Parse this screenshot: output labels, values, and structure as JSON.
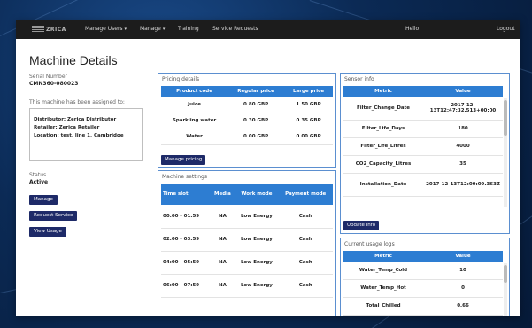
{
  "navbar": {
    "brand": "ZRICA",
    "items": [
      {
        "label": "Manage Users",
        "dropdown": true
      },
      {
        "label": "Manage",
        "dropdown": true
      },
      {
        "label": "Training",
        "dropdown": false
      },
      {
        "label": "Service Requests",
        "dropdown": false
      }
    ],
    "hello": "Hello",
    "logout": "Logout"
  },
  "page": {
    "title": "Machine Details",
    "serial_label": "Serial Number",
    "serial_value": "CMN360-080023",
    "assigned_label": "This machine has been assigned to:",
    "assigned_lines": [
      "Distributor: Zerica Distributor",
      "Retailer: Zerica Retailer",
      "Location: test, line 1, Cambridge"
    ],
    "status_label": "Status",
    "status_value": "Active",
    "buttons": {
      "manage": "Manage",
      "request_service": "Request Service",
      "view_usage": "View Usage"
    }
  },
  "pricing": {
    "title": "Pricing details",
    "headers": [
      "Product code",
      "Regular price",
      "Large price"
    ],
    "rows": [
      [
        "Juice",
        "0.80 GBP",
        "1.50 GBP"
      ],
      [
        "Sparkling water",
        "0.30 GBP",
        "0.35 GBP"
      ],
      [
        "Water",
        "0.00 GBP",
        "0.00 GBP"
      ]
    ],
    "button": "Manage pricing"
  },
  "machine_settings": {
    "title": "Machine settings",
    "headers": [
      "Time slot",
      "Media",
      "Work mode",
      "Payment mode"
    ],
    "rows": [
      [
        "00:00 - 01:59",
        "NA",
        "Low Energy",
        "Cash"
      ],
      [
        "02:00 - 03:59",
        "NA",
        "Low Energy",
        "Cash"
      ],
      [
        "04:00 - 05:59",
        "NA",
        "Low Energy",
        "Cash"
      ],
      [
        "06:00 - 07:59",
        "NA",
        "Low Energy",
        "Cash"
      ]
    ]
  },
  "sensor_info": {
    "title": "Sensor info",
    "headers": [
      "Metric",
      "Value"
    ],
    "rows": [
      [
        "Filter_Change_Date",
        "2017-12-13T12:47:32.513+00:00"
      ],
      [
        "Filter_Life_Days",
        "180"
      ],
      [
        "Filter_Life_Litres",
        "4000"
      ],
      [
        "CO2_Capacity_Litres",
        "35"
      ],
      [
        "Installation_Date",
        "2017-12-13T12:00:09.363Z"
      ]
    ],
    "button": "Update Info"
  },
  "usage_logs": {
    "title": "Current usage logs",
    "headers": [
      "Metric",
      "Value"
    ],
    "rows": [
      [
        "Water_Temp_Cold",
        "10"
      ],
      [
        "Water_Temp_Hot",
        "0"
      ],
      [
        "Total_Chilled",
        "0.66"
      ]
    ]
  }
}
